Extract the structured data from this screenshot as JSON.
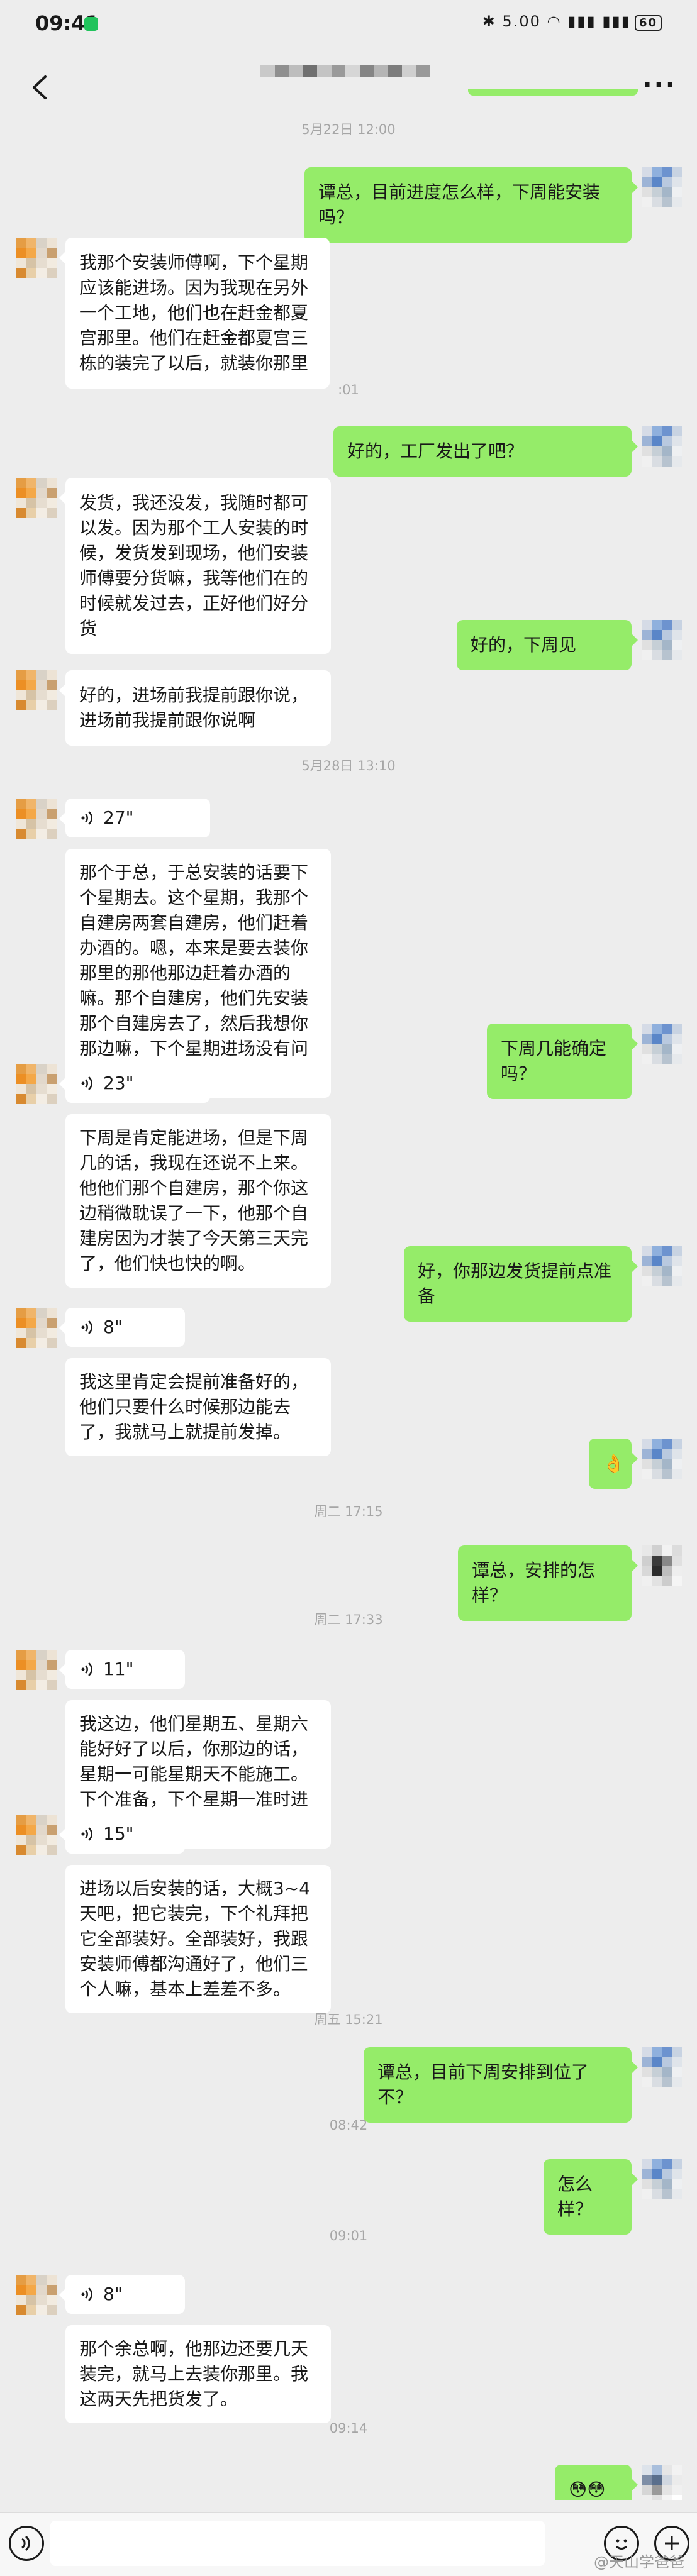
{
  "status_bar": {
    "time": "09:41",
    "icons": "✱ 5.00 ◠ ▮▮▮ ▮▮▮",
    "battery": "60"
  },
  "header": {
    "back_icon": "chevron-left-icon",
    "title_mosaic": [
      "#c9c9c9",
      "#8f8f8f",
      "#bdbdbd",
      "#707070",
      "#c4c4c4",
      "#9a9a9a",
      "#d6d6d6",
      "#858585",
      "#b5b5b5",
      "#7d7d7d",
      "#cfcfcf",
      "#999999"
    ],
    "more_icon": "more-dots-icon"
  },
  "colors": {
    "sent_bubble": "#95ec69",
    "received_bubble": "#ffffff",
    "background": "#ededed"
  },
  "avatars": {
    "other": [
      [
        "#e59d44",
        "#f0b56a",
        "#d9d2c7",
        "#ede3d5"
      ],
      [
        "#ec8f24",
        "#f4a848",
        "#e2d8cb",
        "#c9a070"
      ],
      [
        "#efe6d8",
        "#d6c3a6",
        "#e6ddd0",
        "#f2ebe0"
      ],
      [
        "#d88a30",
        "#e8cfa8",
        "#f3ede4",
        "#dcd0bf"
      ]
    ],
    "me": [
      [
        "#d5dbe6",
        "#8fb0dd",
        "#6d93cf",
        "#c8d3e2"
      ],
      [
        "#9db4d6",
        "#5a86c8",
        "#b9c9df",
        "#dfe4ea"
      ],
      [
        "#e0e0e0",
        "#c6cfd6",
        "#a4b6c8",
        "#eef0f2"
      ],
      [
        "#f0f0f0",
        "#d9dde2",
        "#b7c3cf",
        "#e6e9ec"
      ]
    ],
    "me_alt": [
      [
        "#e8e8e8",
        "#d0d0d0",
        "#f2f2f2",
        "#dcdcdc"
      ],
      [
        "#cfcfcf",
        "#3a3a3a",
        "#888888",
        "#e0e0e0"
      ],
      [
        "#d8d8d8",
        "#2b2b2b",
        "#bdbdbd",
        "#eeeeee"
      ],
      [
        "#f0f0f0",
        "#e2e2e2",
        "#cccccc",
        "#f5f5f5"
      ]
    ],
    "me_blur": [
      [
        "#dde3ea",
        "#a9bfdc",
        "#e6e6e6",
        "#f2f2f2"
      ],
      [
        "#7e8ea6",
        "#5a6f8c",
        "#d0d7e0",
        "#ebebeb"
      ],
      [
        "#d6d6d6",
        "#9a9a9a",
        "#e4e4e4",
        "#f0f0f0"
      ],
      [
        "#eeeeee",
        "#e0e0e0",
        "#f4f4f4",
        "#ffffff"
      ]
    ]
  },
  "messages": [
    {
      "type": "time",
      "text": "5月22日 12:00"
    },
    {
      "type": "out",
      "text": "谭总，目前进度怎么样，下周能安装吗？"
    },
    {
      "type": "in",
      "text": "我那个安装师傅啊，下个星期应该能进场。因为我现在另外一个工地，他们也在赶金都夏宫那里。他们在赶金都夏宫三栋的装完了以后，就装你那里"
    },
    {
      "type": "time",
      "text": ":01"
    },
    {
      "type": "out",
      "text": "好的，工厂发出了吧？"
    },
    {
      "type": "in",
      "text": "发货，我还没发，我随时都可以发。因为那个工人安装的时候，发货发到现场，他们安装师傅要分货嘛，我等他们在的时候就发过去，正好他们好分货"
    },
    {
      "type": "out",
      "text": "好的，下周见"
    },
    {
      "type": "in",
      "text": "好的，进场前我提前跟你说，进场前我提前跟你说啊"
    },
    {
      "type": "time",
      "text": "5月28日 13:10"
    },
    {
      "type": "voice",
      "duration": "27\"",
      "text": "那个于总，于总安装的话要下个星期去。这个星期，我那个自建房两套自建房，他们赶着办酒的。嗯，本来是要去装你那里的那他那边赶着办酒的嘛。那个自建房，他们先安装那个自建房去了，然后我想你那边嘛，下个星期进场没有问题的。"
    },
    {
      "type": "out",
      "text": "下周几能确定吗？"
    },
    {
      "type": "voice",
      "duration": "23\"",
      "text": "下周是肯定能进场，但是下周几的话，我现在还说不上来。他他们那个自建房，那个你这边稍微耽误了一下，他那个自建房因为才装了今天第三天完了，他们快也快的啊。"
    },
    {
      "type": "out",
      "text": "好，你那边发货提前点准备"
    },
    {
      "type": "voice",
      "duration": "8\"",
      "text": "我这里肯定会提前准备好的，他们只要什么时候那边能去了，我就马上就提前发掉。"
    },
    {
      "type": "out",
      "text": "👌"
    },
    {
      "type": "time",
      "text": "周二 17:15"
    },
    {
      "type": "out",
      "text": "谭总，安排的怎样？"
    },
    {
      "type": "time",
      "text": "周二 17:33"
    },
    {
      "type": "voice",
      "duration": "11\"",
      "text": "我这边，他们星期五、星期六能好好了以后，你那边的话，星期一可能星期天不能施工。下个准备，下个星期一准时进场。"
    },
    {
      "type": "voice",
      "duration": "15\"",
      "text": "进场以后安装的话，大概3~4天吧，把它装完，下个礼拜把它全部装好。全部装好，我跟安装师傅都沟通好了，他们三个人嘛，基本上差差不多。"
    },
    {
      "type": "time",
      "text": "周五 15:21"
    },
    {
      "type": "out",
      "text": "谭总，目前下周安排到位了不？"
    },
    {
      "type": "time",
      "text": "08:42"
    },
    {
      "type": "out",
      "text": "怎么样？"
    },
    {
      "type": "time",
      "text": "09:01"
    },
    {
      "type": "voice",
      "duration": "8\"",
      "text": "那个余总啊，他那边还要几天装完，就马上去装你那里。我这两天先把货发了。"
    },
    {
      "type": "time",
      "text": "09:14"
    },
    {
      "type": "out",
      "text": "😳😳😳"
    }
  ],
  "input_bar": {
    "voice_icon": "voice-icon",
    "emoji_icon": "emoji-icon",
    "plus_icon": "plus-icon"
  },
  "watermark": "@天山学爸爸"
}
